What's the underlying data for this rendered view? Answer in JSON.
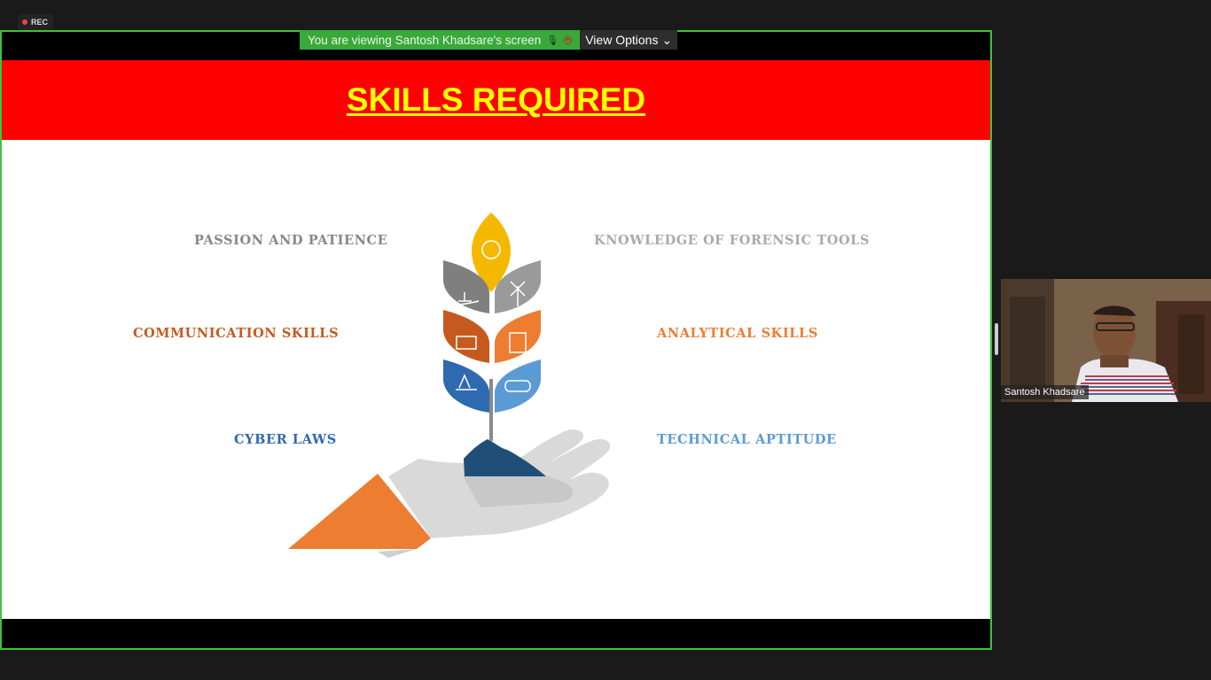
{
  "recording": {
    "label": "REC"
  },
  "share_banner": {
    "viewing_text": "You are viewing Santosh Khadsare's screen",
    "view_options_label": "View Options"
  },
  "slide": {
    "title": "SKILLS REQUIRED",
    "skills": [
      {
        "label": "PASSION AND PATIENCE",
        "color": "#888888"
      },
      {
        "label": "KNOWLEDGE OF FORENSIC TOOLS",
        "color": "#aaaaaa"
      },
      {
        "label": "COMMUNICATION SKILLS",
        "color": "#c65a1e"
      },
      {
        "label": "ANALYTICAL SKILLS",
        "color": "#ed7d31"
      },
      {
        "label": "CYBER LAWS",
        "color": "#2e6ab0"
      },
      {
        "label": "TECHNICAL APTITUDE",
        "color": "#5b9bd5"
      }
    ],
    "colors": {
      "header_bg": "#ff0000",
      "title": "#ffff00"
    }
  },
  "participant": {
    "name": "Santosh Khadsare"
  },
  "colors": {
    "share_border": "#3cc43c",
    "background": "#1a1a1a"
  }
}
